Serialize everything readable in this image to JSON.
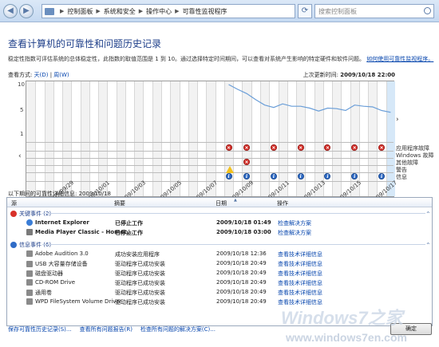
{
  "address": {
    "crumbs": [
      "控制面板",
      "系统和安全",
      "操作中心",
      "可靠性监视程序"
    ],
    "search_placeholder": "搜索控制面板"
  },
  "header": {
    "title": "查看计算机的可靠性和问题历史记录",
    "description": "稳定性指数可评估系统的总体稳定性，此指数的取值范围是 1 到 10。通过选择特定时间期间，可以查看对系统产生影响的特定硬件和软件问题。",
    "link": "如何使用可靠性监视程序。"
  },
  "view": {
    "label": "查看方式:",
    "by_day": "天(D)",
    "sep": "|",
    "by_week": "周(W)",
    "updated_label": "上次更新时间:",
    "updated_value": "2009/10/18 22:00"
  },
  "chart_data": {
    "type": "line",
    "ylim": [
      1,
      10
    ],
    "yticks": [
      "10",
      "5",
      "1"
    ],
    "dates": [
      "2009/09/29",
      "2009/10/01",
      "2009/10/03",
      "2009/10/05",
      "2009/10/07",
      "2009/10/09",
      "2009/10/11",
      "2009/10/13",
      "2009/10/15",
      "2009/10/17"
    ],
    "series": [
      {
        "values": [
          null,
          null,
          null,
          null,
          null,
          null,
          null,
          null,
          null,
          null,
          null,
          null,
          null,
          null,
          null,
          null,
          null,
          null,
          null,
          null,
          null,
          null,
          10,
          9.2,
          8.5,
          7.5,
          6.6,
          6.2,
          6.8,
          6.4,
          6.4,
          6.1,
          5.6,
          6.1,
          6.0,
          5.7,
          6.6,
          6.4,
          6.3,
          5.7,
          5.4
        ]
      }
    ],
    "row_labels": [
      "应用程序故障",
      "Windows 故障",
      "其他故障",
      "警告",
      "信息"
    ],
    "events": {
      "app_failures": [
        22,
        24,
        27,
        30,
        33,
        36,
        39
      ],
      "windows_failures": [],
      "other_failures": [
        24
      ],
      "warnings": [
        22
      ],
      "info": [
        22,
        24,
        27,
        30,
        33,
        36,
        39
      ]
    }
  },
  "details": {
    "title_prefix": "以下期间的可靠性详细信息:",
    "date": "2009/10/18",
    "columns": [
      "源",
      "摘要",
      "日期",
      "操作"
    ],
    "critical": {
      "label": "关键事件 (2)",
      "rows": [
        {
          "source": "Internet Explorer",
          "summary": "已停止工作",
          "date": "2009/10/18 01:49",
          "action": "检查解决方案"
        },
        {
          "source": "Media Player Classic - Homec...",
          "summary": "已停止工作",
          "date": "2009/10/18 03:00",
          "action": "检查解决方案"
        }
      ]
    },
    "info": {
      "label": "信息事件 (6)",
      "rows": [
        {
          "source": "Adobe Audition 3.0",
          "summary": "成功安装应用程序",
          "date": "2009/10/18 12:36",
          "action": "查看技术详细信息"
        },
        {
          "source": "USB 大容量存储设备",
          "summary": "驱动程序已成功安装",
          "date": "2009/10/18 20:49",
          "action": "查看技术详细信息"
        },
        {
          "source": "磁盘驱动器",
          "summary": "驱动程序已成功安装",
          "date": "2009/10/18 20:49",
          "action": "查看技术详细信息"
        },
        {
          "source": "CD-ROM Drive",
          "summary": "驱动程序已成功安装",
          "date": "2009/10/18 20:49",
          "action": "查看技术详细信息"
        },
        {
          "source": "通用卷",
          "summary": "驱动程序已成功安装",
          "date": "2009/10/18 20:49",
          "action": "查看技术详细信息"
        },
        {
          "source": "WPD FileSystem Volume Driver",
          "summary": "驱动程序已成功安装",
          "date": "2009/10/18 20:49",
          "action": "查看技术详细信息"
        }
      ]
    }
  },
  "footer": {
    "save": "保存可靠性历史记录(S)...",
    "all_reports": "查看所有问题报告(R)",
    "check_all": "检查所有问题的解决方案(C)...",
    "ok": "确定"
  },
  "watermark": {
    "brand": "Windows7之家",
    "url": "www.windows7en.com"
  },
  "colors": {
    "title": "#1e3f8a",
    "link": "#0645ad",
    "line": "#6a9ed8",
    "selected_column": "#d6e8f8"
  }
}
